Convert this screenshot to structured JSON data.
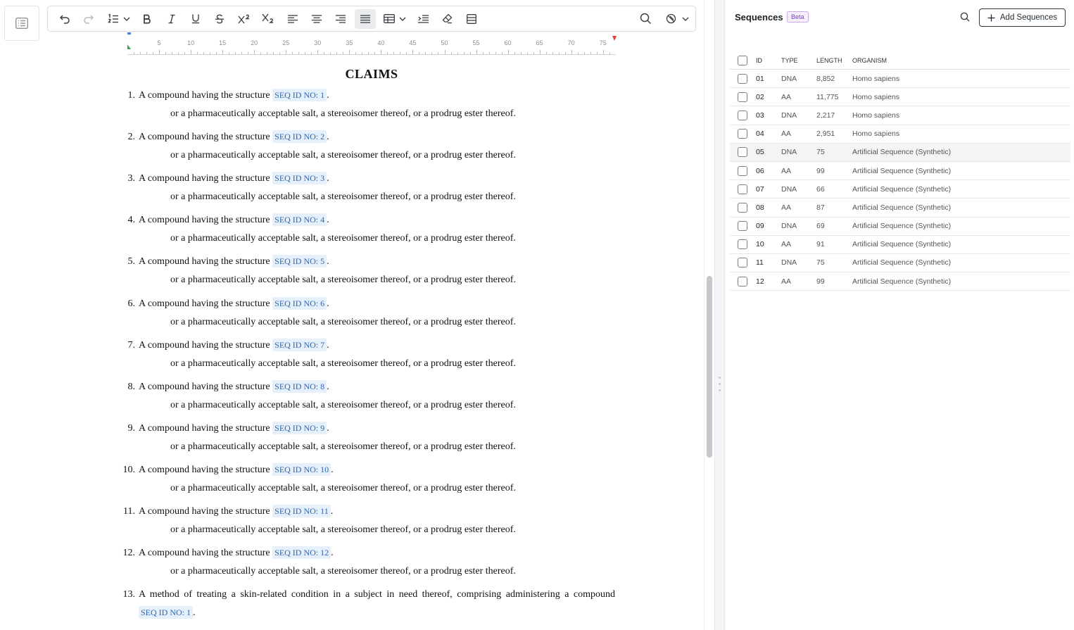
{
  "toolbar": {
    "items": [
      "undo-icon",
      "redo-icon",
      "numbered-list-icon",
      "bold-icon",
      "italic-icon",
      "underline-icon",
      "strikethrough-icon",
      "superscript-icon",
      "subscript-icon",
      "align-left-icon",
      "align-center-icon",
      "align-right-icon",
      "align-justify-icon",
      "table-icon",
      "indent-icon",
      "clear-format-icon",
      "layout-icon",
      "search-icon",
      "no-highlight-icon"
    ],
    "active": "align-justify-icon"
  },
  "ruler": {
    "labels": [
      "5",
      "10",
      "15",
      "20",
      "25",
      "30",
      "35",
      "40",
      "45",
      "50",
      "55",
      "60",
      "65",
      "70",
      "75"
    ]
  },
  "document": {
    "title": "CLAIMS",
    "claim_prefix": "A compound having the structure",
    "claim_suffix": "or a pharmaceutically acceptable salt, a stereoisomer thereof, or a prodrug ester thereof.",
    "claims": [
      {
        "num": "1.",
        "seq": "SEQ ID NO: 1"
      },
      {
        "num": "2.",
        "seq": "SEQ ID NO: 2"
      },
      {
        "num": "3.",
        "seq": "SEQ ID NO: 3"
      },
      {
        "num": "4.",
        "seq": "SEQ ID NO: 4"
      },
      {
        "num": "5.",
        "seq": "SEQ ID NO: 5"
      },
      {
        "num": "6.",
        "seq": "SEQ ID NO: 6"
      },
      {
        "num": "7.",
        "seq": "SEQ ID NO: 7"
      },
      {
        "num": "8.",
        "seq": "SEQ ID NO: 8"
      },
      {
        "num": "9.",
        "seq": "SEQ ID NO: 9"
      },
      {
        "num": "10.",
        "seq": "SEQ ID NO: 10"
      },
      {
        "num": "11.",
        "seq": "SEQ ID NO: 11"
      },
      {
        "num": "12.",
        "seq": "SEQ ID NO: 12"
      }
    ],
    "claim13": {
      "num": "13.",
      "text": "A method of treating a skin-related condition in a subject in need thereof, comprising administering a compound",
      "seq": "SEQ ID NO: 1"
    }
  },
  "panel": {
    "title": "Sequences",
    "badge": "Beta",
    "add_label": "Add Sequences",
    "columns": {
      "id": "ID",
      "type": "TYPE",
      "length": "LENGTH",
      "organism": "ORGANISM"
    },
    "rows": [
      {
        "id": "01",
        "type": "DNA",
        "length": "8,852",
        "organism": "Homo sapiens"
      },
      {
        "id": "02",
        "type": "AA",
        "length": "11,775",
        "organism": "Homo sapiens"
      },
      {
        "id": "03",
        "type": "DNA",
        "length": "2,217",
        "organism": "Homo sapiens"
      },
      {
        "id": "04",
        "type": "AA",
        "length": "2,951",
        "organism": "Homo sapiens"
      },
      {
        "id": "05",
        "type": "DNA",
        "length": "75",
        "organism": "Artificial Sequence (Synthetic)"
      },
      {
        "id": "06",
        "type": "AA",
        "length": "99",
        "organism": "Artificial Sequence (Synthetic)"
      },
      {
        "id": "07",
        "type": "DNA",
        "length": "66",
        "organism": "Artificial Sequence (Synthetic)"
      },
      {
        "id": "08",
        "type": "AA",
        "length": "87",
        "organism": "Artificial Sequence (Synthetic)"
      },
      {
        "id": "09",
        "type": "DNA",
        "length": "69",
        "organism": "Artificial Sequence (Synthetic)"
      },
      {
        "id": "10",
        "type": "AA",
        "length": "91",
        "organism": "Artificial Sequence (Synthetic)"
      },
      {
        "id": "11",
        "type": "DNA",
        "length": "75",
        "organism": "Artificial Sequence (Synthetic)"
      },
      {
        "id": "12",
        "type": "AA",
        "length": "99",
        "organism": "Artificial Sequence (Synthetic)"
      }
    ],
    "hover_row": "05"
  },
  "colors": {
    "chip_bg": "#e6f0fb",
    "chip_text": "#2e67b1",
    "beta_text": "#7b3fb5",
    "beta_border": "#c9a8e8",
    "ruler_left_marker": "#3aa845",
    "ruler_right_marker": "#e23b3b"
  }
}
